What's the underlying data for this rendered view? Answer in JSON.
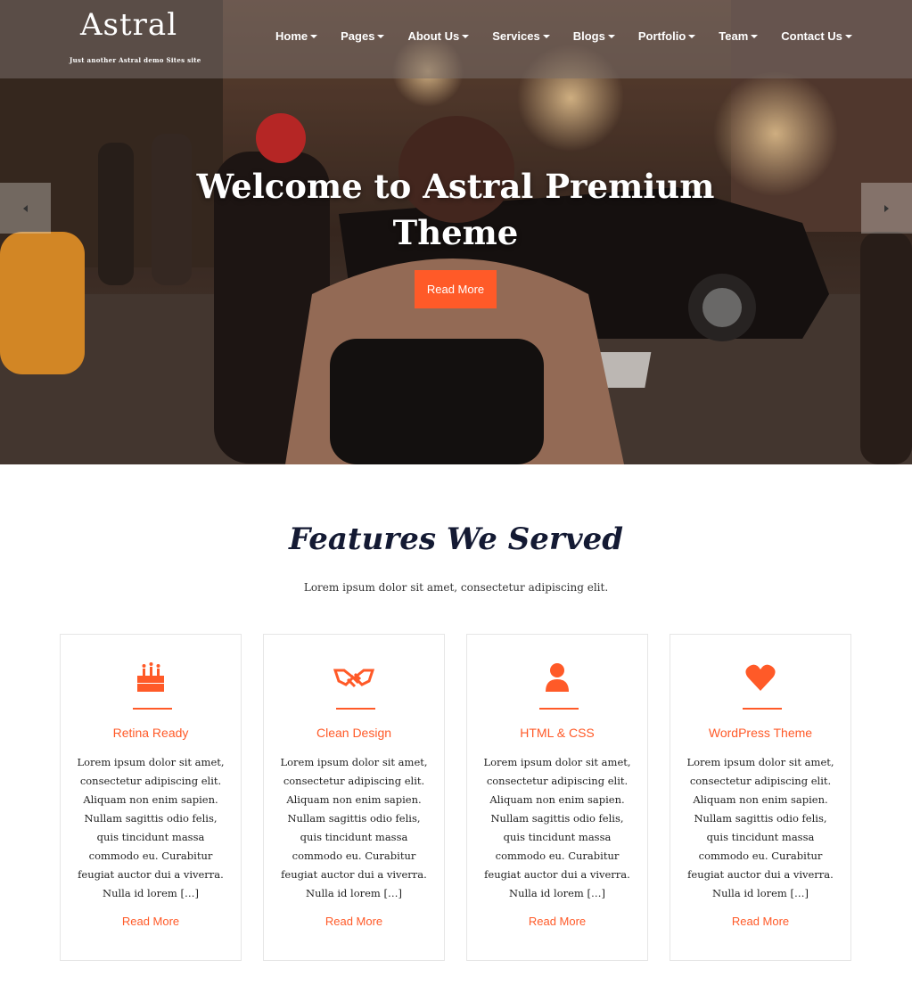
{
  "header": {
    "logo": "Astral",
    "tagline": "Just another Astral demo Sites site",
    "nav": [
      "Home",
      "Pages",
      "About Us",
      "Services",
      "Blogs",
      "Portfolio",
      "Team",
      "Contact Us"
    ]
  },
  "hero": {
    "title": "Welcome to Astral Premium Theme",
    "button": "Read More"
  },
  "features": {
    "title": "Features We Served",
    "subtitle": "Lorem ipsum dolor sit amet, consectetur adipiscing elit.",
    "cards": [
      {
        "icon": "cake-icon",
        "title": "Retina Ready",
        "text": "Lorem ipsum dolor sit amet, consectetur adipiscing elit. Aliquam non enim sapien. Nullam sagittis odio felis, quis tincidunt massa commodo eu. Curabitur feugiat auctor dui a viverra. Nulla id lorem […]",
        "link": "Read More"
      },
      {
        "icon": "handshake-icon",
        "title": "Clean Design",
        "text": "Lorem ipsum dolor sit amet, consectetur adipiscing elit. Aliquam non enim sapien. Nullam sagittis odio felis, quis tincidunt massa commodo eu. Curabitur feugiat auctor dui a viverra. Nulla id lorem […]",
        "link": "Read More"
      },
      {
        "icon": "user-icon",
        "title": "HTML & CSS",
        "text": "Lorem ipsum dolor sit amet, consectetur adipiscing elit. Aliquam non enim sapien. Nullam sagittis odio felis, quis tincidunt massa commodo eu. Curabitur feugiat auctor dui a viverra. Nulla id lorem […]",
        "link": "Read More"
      },
      {
        "icon": "heart-icon",
        "title": "WordPress Theme",
        "text": "Lorem ipsum dolor sit amet, consectetur adipiscing elit. Aliquam non enim sapien. Nullam sagittis odio felis, quis tincidunt massa commodo eu. Curabitur feugiat auctor dui a viverra. Nulla id lorem […]",
        "link": "Read More"
      }
    ]
  },
  "colors": {
    "accent": "#ff5a28",
    "heading": "#141a33"
  }
}
